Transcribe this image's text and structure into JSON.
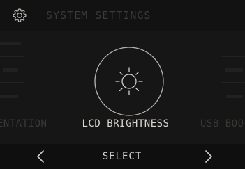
{
  "header": {
    "title": "SYSTEM SETTINGS",
    "icon": "gear-icon"
  },
  "carousel": {
    "current": {
      "label": "LCD BRIGHTNESS",
      "icon": "sun-icon"
    },
    "previous_label": "ENTATION",
    "next_label": "USB BOO"
  },
  "footer": {
    "select_label": "SELECT",
    "prev_icon": "chevron-left-icon",
    "next_icon": "chevron-right-icon"
  },
  "colors": {
    "background": "#171616",
    "text": "#d9d6cf",
    "dim_text": "#3a3835",
    "divider": "#6e6b66"
  }
}
